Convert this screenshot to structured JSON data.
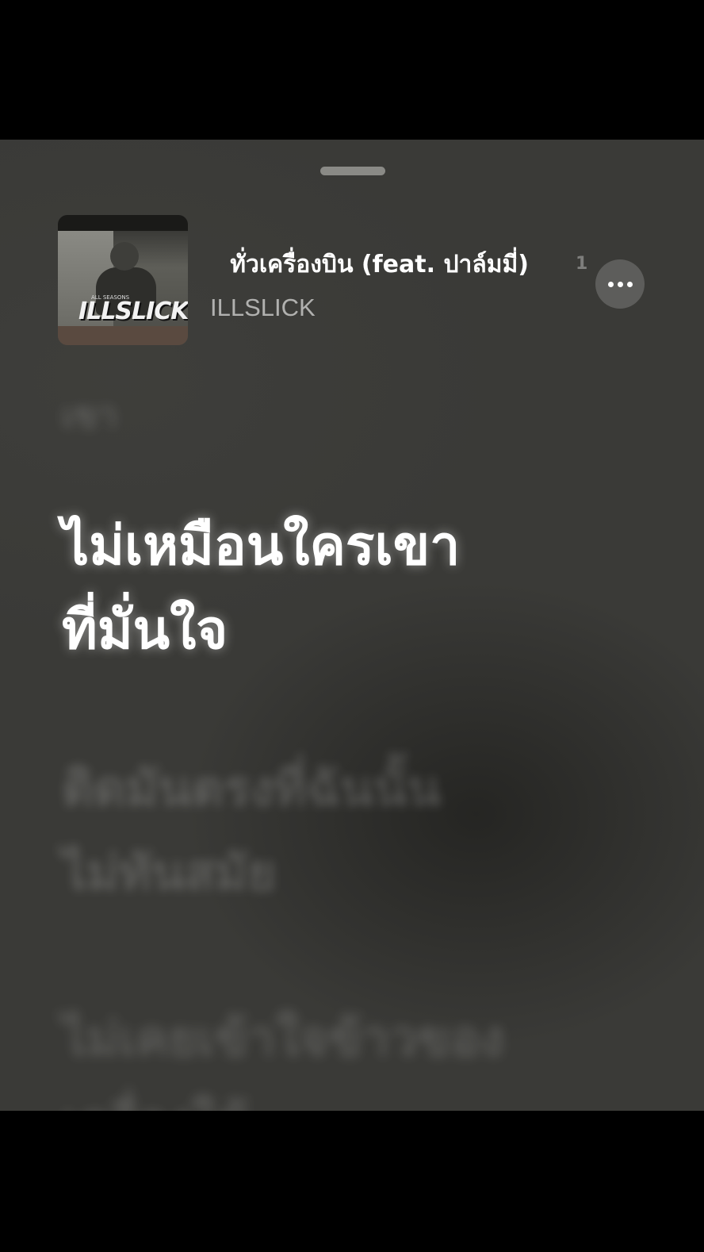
{
  "now_playing": {
    "song_title": "ทั่วเครื่องบิน (feat. ปาล์มมี่)",
    "title_overflow_glyph": "1",
    "artist": "ILLSLICK",
    "artwork": {
      "label": "ILLSLICK",
      "small_text": "ALL SEASONS"
    },
    "more_button_icon": "ellipsis-icon"
  },
  "lyrics": {
    "previous": "เขา",
    "current": [
      "ไม่เหมือนใครเขา",
      "ที่มั่นใจ"
    ],
    "next": [
      [
        "ติดมันตรงที่ฉันนั้น",
        "ไม่ทันสมัย"
      ],
      [
        "ไม่เคยเข้าใจข้าวของ",
        "เครื่องใช้"
      ]
    ]
  },
  "colors": {
    "background": "#000000",
    "sheet": "#3a3a37",
    "active_lyric": "#ffffff",
    "inactive_lyric": "rgba(255,255,255,0.18)"
  }
}
